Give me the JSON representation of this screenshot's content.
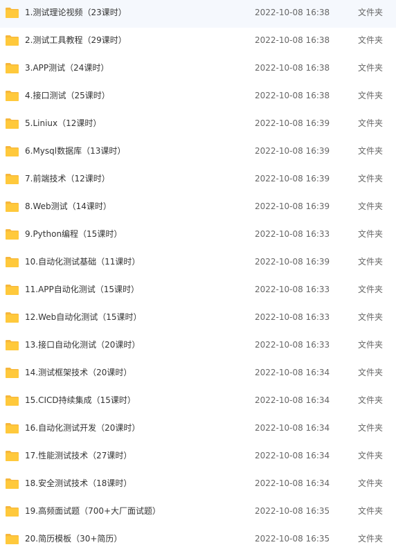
{
  "colors": {
    "folder": "#ffc93c",
    "folder_dark": "#f6b73c",
    "text": "#333333",
    "subtext": "#666666"
  },
  "files": [
    {
      "name": "1.测试理论视频（23课时）",
      "date": "2022-10-08 16:38",
      "type": "文件夹",
      "icon": "folder-icon"
    },
    {
      "name": "2.测试工具教程（29课时）",
      "date": "2022-10-08 16:38",
      "type": "文件夹",
      "icon": "folder-icon"
    },
    {
      "name": "3.APP测试（24课时）",
      "date": "2022-10-08 16:38",
      "type": "文件夹",
      "icon": "folder-icon"
    },
    {
      "name": "4.接口测试（25课时）",
      "date": "2022-10-08 16:38",
      "type": "文件夹",
      "icon": "folder-icon"
    },
    {
      "name": "5.Liniux（12课时）",
      "date": "2022-10-08 16:39",
      "type": "文件夹",
      "icon": "folder-icon"
    },
    {
      "name": "6.Mysql数据库（13课时）",
      "date": "2022-10-08 16:39",
      "type": "文件夹",
      "icon": "folder-icon"
    },
    {
      "name": "7.前端技术（12课时）",
      "date": "2022-10-08 16:39",
      "type": "文件夹",
      "icon": "folder-icon"
    },
    {
      "name": "8.Web测试（14课时）",
      "date": "2022-10-08 16:39",
      "type": "文件夹",
      "icon": "folder-icon"
    },
    {
      "name": "9.Python编程（15课时）",
      "date": "2022-10-08 16:33",
      "type": "文件夹",
      "icon": "folder-icon"
    },
    {
      "name": "10.自动化测试基础（11课时）",
      "date": "2022-10-08 16:39",
      "type": "文件夹",
      "icon": "folder-icon"
    },
    {
      "name": "11.APP自动化测试（15课时）",
      "date": "2022-10-08 16:33",
      "type": "文件夹",
      "icon": "folder-icon"
    },
    {
      "name": "12.Web自动化测试（15课时）",
      "date": "2022-10-08 16:33",
      "type": "文件夹",
      "icon": "folder-icon"
    },
    {
      "name": "13.接口自动化测试（20课时）",
      "date": "2022-10-08 16:33",
      "type": "文件夹",
      "icon": "folder-icon"
    },
    {
      "name": "14.测试框架技术（20课时）",
      "date": "2022-10-08 16:34",
      "type": "文件夹",
      "icon": "folder-icon"
    },
    {
      "name": "15.CICD持续集成（15课时）",
      "date": "2022-10-08 16:34",
      "type": "文件夹",
      "icon": "folder-icon"
    },
    {
      "name": "16.自动化测试开发（20课时）",
      "date": "2022-10-08 16:34",
      "type": "文件夹",
      "icon": "folder-icon"
    },
    {
      "name": "17.性能测试技术（27课时）",
      "date": "2022-10-08 16:34",
      "type": "文件夹",
      "icon": "folder-icon"
    },
    {
      "name": "18.安全测试技术（18课时）",
      "date": "2022-10-08 16:34",
      "type": "文件夹",
      "icon": "folder-icon"
    },
    {
      "name": "19.高频面试题（700+大厂面试题）",
      "date": "2022-10-08 16:35",
      "type": "文件夹",
      "icon": "folder-icon"
    },
    {
      "name": "20.简历模板（30+简历）",
      "date": "2022-10-08 16:35",
      "type": "文件夹",
      "icon": "folder-icon"
    }
  ]
}
